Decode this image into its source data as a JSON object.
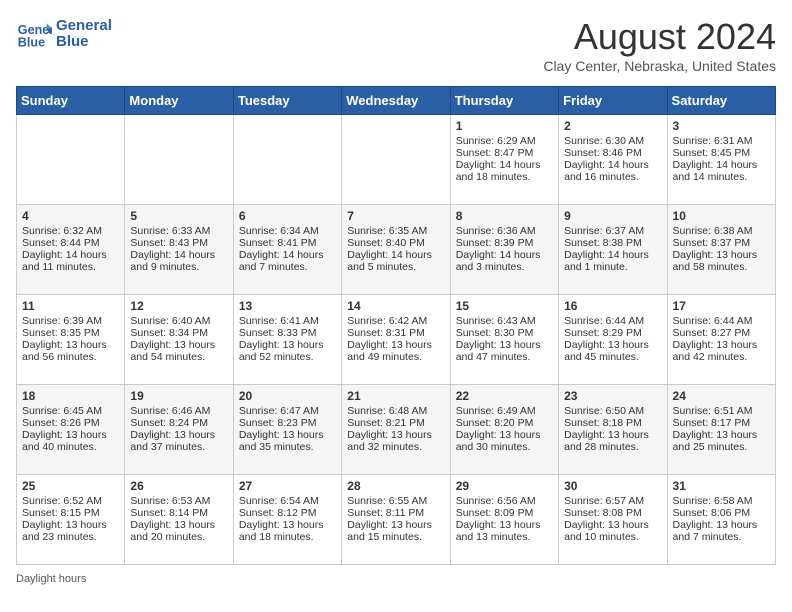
{
  "header": {
    "title": "August 2024",
    "location": "Clay Center, Nebraska, United States",
    "logo_line1": "General",
    "logo_line2": "Blue"
  },
  "days_of_week": [
    "Sunday",
    "Monday",
    "Tuesday",
    "Wednesday",
    "Thursday",
    "Friday",
    "Saturday"
  ],
  "weeks": [
    [
      {
        "day": "",
        "info": ""
      },
      {
        "day": "",
        "info": ""
      },
      {
        "day": "",
        "info": ""
      },
      {
        "day": "",
        "info": ""
      },
      {
        "day": "1",
        "info": "Sunrise: 6:29 AM\nSunset: 8:47 PM\nDaylight: 14 hours and 18 minutes."
      },
      {
        "day": "2",
        "info": "Sunrise: 6:30 AM\nSunset: 8:46 PM\nDaylight: 14 hours and 16 minutes."
      },
      {
        "day": "3",
        "info": "Sunrise: 6:31 AM\nSunset: 8:45 PM\nDaylight: 14 hours and 14 minutes."
      }
    ],
    [
      {
        "day": "4",
        "info": "Sunrise: 6:32 AM\nSunset: 8:44 PM\nDaylight: 14 hours and 11 minutes."
      },
      {
        "day": "5",
        "info": "Sunrise: 6:33 AM\nSunset: 8:43 PM\nDaylight: 14 hours and 9 minutes."
      },
      {
        "day": "6",
        "info": "Sunrise: 6:34 AM\nSunset: 8:41 PM\nDaylight: 14 hours and 7 minutes."
      },
      {
        "day": "7",
        "info": "Sunrise: 6:35 AM\nSunset: 8:40 PM\nDaylight: 14 hours and 5 minutes."
      },
      {
        "day": "8",
        "info": "Sunrise: 6:36 AM\nSunset: 8:39 PM\nDaylight: 14 hours and 3 minutes."
      },
      {
        "day": "9",
        "info": "Sunrise: 6:37 AM\nSunset: 8:38 PM\nDaylight: 14 hours and 1 minute."
      },
      {
        "day": "10",
        "info": "Sunrise: 6:38 AM\nSunset: 8:37 PM\nDaylight: 13 hours and 58 minutes."
      }
    ],
    [
      {
        "day": "11",
        "info": "Sunrise: 6:39 AM\nSunset: 8:35 PM\nDaylight: 13 hours and 56 minutes."
      },
      {
        "day": "12",
        "info": "Sunrise: 6:40 AM\nSunset: 8:34 PM\nDaylight: 13 hours and 54 minutes."
      },
      {
        "day": "13",
        "info": "Sunrise: 6:41 AM\nSunset: 8:33 PM\nDaylight: 13 hours and 52 minutes."
      },
      {
        "day": "14",
        "info": "Sunrise: 6:42 AM\nSunset: 8:31 PM\nDaylight: 13 hours and 49 minutes."
      },
      {
        "day": "15",
        "info": "Sunrise: 6:43 AM\nSunset: 8:30 PM\nDaylight: 13 hours and 47 minutes."
      },
      {
        "day": "16",
        "info": "Sunrise: 6:44 AM\nSunset: 8:29 PM\nDaylight: 13 hours and 45 minutes."
      },
      {
        "day": "17",
        "info": "Sunrise: 6:44 AM\nSunset: 8:27 PM\nDaylight: 13 hours and 42 minutes."
      }
    ],
    [
      {
        "day": "18",
        "info": "Sunrise: 6:45 AM\nSunset: 8:26 PM\nDaylight: 13 hours and 40 minutes."
      },
      {
        "day": "19",
        "info": "Sunrise: 6:46 AM\nSunset: 8:24 PM\nDaylight: 13 hours and 37 minutes."
      },
      {
        "day": "20",
        "info": "Sunrise: 6:47 AM\nSunset: 8:23 PM\nDaylight: 13 hours and 35 minutes."
      },
      {
        "day": "21",
        "info": "Sunrise: 6:48 AM\nSunset: 8:21 PM\nDaylight: 13 hours and 32 minutes."
      },
      {
        "day": "22",
        "info": "Sunrise: 6:49 AM\nSunset: 8:20 PM\nDaylight: 13 hours and 30 minutes."
      },
      {
        "day": "23",
        "info": "Sunrise: 6:50 AM\nSunset: 8:18 PM\nDaylight: 13 hours and 28 minutes."
      },
      {
        "day": "24",
        "info": "Sunrise: 6:51 AM\nSunset: 8:17 PM\nDaylight: 13 hours and 25 minutes."
      }
    ],
    [
      {
        "day": "25",
        "info": "Sunrise: 6:52 AM\nSunset: 8:15 PM\nDaylight: 13 hours and 23 minutes."
      },
      {
        "day": "26",
        "info": "Sunrise: 6:53 AM\nSunset: 8:14 PM\nDaylight: 13 hours and 20 minutes."
      },
      {
        "day": "27",
        "info": "Sunrise: 6:54 AM\nSunset: 8:12 PM\nDaylight: 13 hours and 18 minutes."
      },
      {
        "day": "28",
        "info": "Sunrise: 6:55 AM\nSunset: 8:11 PM\nDaylight: 13 hours and 15 minutes."
      },
      {
        "day": "29",
        "info": "Sunrise: 6:56 AM\nSunset: 8:09 PM\nDaylight: 13 hours and 13 minutes."
      },
      {
        "day": "30",
        "info": "Sunrise: 6:57 AM\nSunset: 8:08 PM\nDaylight: 13 hours and 10 minutes."
      },
      {
        "day": "31",
        "info": "Sunrise: 6:58 AM\nSunset: 8:06 PM\nDaylight: 13 hours and 7 minutes."
      }
    ]
  ],
  "footer": {
    "label": "Daylight hours"
  },
  "colors": {
    "header_bg": "#2b5fa5",
    "logo_color": "#2b5fa5"
  }
}
